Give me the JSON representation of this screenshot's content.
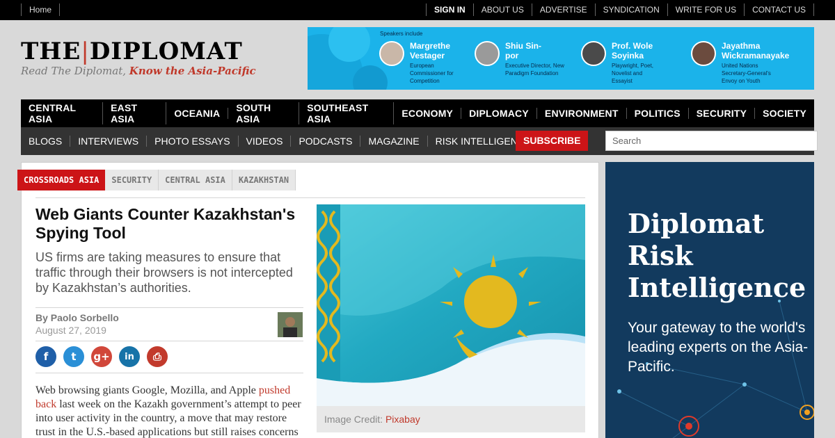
{
  "topbar": {
    "home": "Home",
    "links": [
      "SIGN IN",
      "ABOUT US",
      "ADVERTISE",
      "SYNDICATION",
      "WRITE FOR US",
      "CONTACT US"
    ]
  },
  "logo": {
    "name_left": "THE",
    "name_right": "DIPLOMAT",
    "tagline_plain": "Read The Diplomat, ",
    "tagline_bold": "Know the Asia-Pacific"
  },
  "banner": {
    "label": "Speakers include",
    "speakers": [
      {
        "name": "Margrethe Vestager",
        "title": "European Commissioner for Competition"
      },
      {
        "name": "Shiu Sin-por",
        "title": "Executive Director, New Paradigm Foundation"
      },
      {
        "name": "Prof. Wole Soyinka",
        "title": "Playwright, Poet, Novelist and Essayist"
      },
      {
        "name": "Jayathma Wickramanayake",
        "title": "United Nations Secretary-General's Envoy on Youth"
      }
    ]
  },
  "mainnav": [
    "CENTRAL ASIA",
    "EAST ASIA",
    "OCEANIA",
    "SOUTH ASIA",
    "SOUTHEAST ASIA",
    "ECONOMY",
    "DIPLOMACY",
    "ENVIRONMENT",
    "POLITICS",
    "SECURITY",
    "SOCIETY"
  ],
  "subnav": {
    "items": [
      "BLOGS",
      "INTERVIEWS",
      "PHOTO ESSAYS",
      "VIDEOS",
      "PODCASTS",
      "MAGAZINE",
      "RISK INTELLIGENCE"
    ],
    "subscribe": "SUBSCRIBE",
    "search_placeholder": "Search"
  },
  "article": {
    "tags": [
      "CROSSROADS ASIA",
      "SECURITY",
      "CENTRAL ASIA",
      "KAZAKHSTAN"
    ],
    "headline": "Web Giants Counter Kazakhstan's Spying Tool",
    "dek": "US firms are taking measures to ensure that traffic through their browsers is not intercepted by Kazakhstan’s authorities.",
    "author": "By Paolo Sorbello",
    "date": "August 27, 2019",
    "share": [
      {
        "icon": "facebook-icon",
        "glyph": "f",
        "color": "#1f5fa8"
      },
      {
        "icon": "twitter-icon",
        "glyph": "t",
        "color": "#2a8fd6"
      },
      {
        "icon": "google-plus-icon",
        "glyph": "g+",
        "color": "#d1473a"
      },
      {
        "icon": "linkedin-icon",
        "glyph": "in",
        "color": "#1773a8"
      },
      {
        "icon": "print-icon",
        "glyph": "⎙",
        "color": "#c23a2c"
      }
    ],
    "body_pre": "Web browsing giants Google, Mozilla, and Apple ",
    "body_link": "pushed back",
    "body_post": " last week on the Kazakh government’s attempt to peer into user activity in the country, a move that may restore trust in the U.S.-based applications but still raises concerns",
    "caption_label": "Image Credit: ",
    "caption_link": "Pixabay"
  },
  "sidebar_ad": {
    "headline": "Diplomat Risk Intelligence",
    "subline": "Your gateway to the world's leading experts on the Asia-Pacific."
  },
  "colors": {
    "accent": "#cc1417",
    "flag_blue": "#2ab5cc",
    "flag_gold": "#e3b91f",
    "banner_blue": "#1bb3ea",
    "sidebar_navy": "#123a5e"
  }
}
